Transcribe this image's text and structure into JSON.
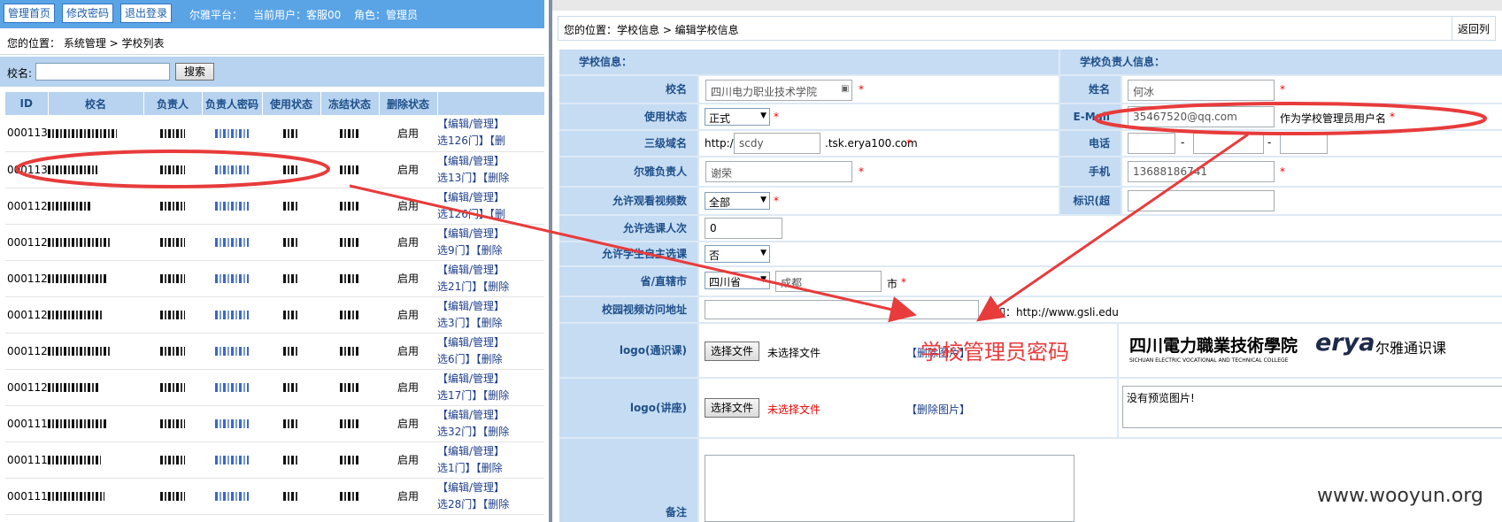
{
  "left": {
    "nav": {
      "home": "管理首页",
      "change_password": "修改密码",
      "logout": "退出登录",
      "platform": "尔雅平台：",
      "current_user": "当前用户：客服00",
      "role": "角色：管理员"
    },
    "breadcrumb": "您的位置： 系统管理 > 学校列表",
    "search": {
      "label": "校名:",
      "value": "",
      "button": "搜索"
    },
    "columns": [
      "ID",
      "校名",
      "负责人",
      "负责人密码",
      "使用状态",
      "冻结状态",
      "删除状态"
    ],
    "rows": [
      {
        "id": "000113",
        "state": "启用",
        "ops1": "【编辑/管理】",
        "ops2": "选126门】【删"
      },
      {
        "id": "000113",
        "state": "启用",
        "ops1": "【编辑/管理】",
        "ops2": "选13门】【删除"
      },
      {
        "id": "000112",
        "state": "启用",
        "ops1": "【编辑/管理】",
        "ops2": "选126门】【删"
      },
      {
        "id": "000112",
        "state": "启用",
        "ops1": "【编辑/管理】",
        "ops2": "选9门】【删除"
      },
      {
        "id": "000112",
        "state": "启用",
        "ops1": "【编辑/管理】",
        "ops2": "选21门】【删除"
      },
      {
        "id": "000112",
        "state": "启用",
        "ops1": "【编辑/管理】",
        "ops2": "选3门】【删除"
      },
      {
        "id": "000112",
        "state": "启用",
        "ops1": "【编辑/管理】",
        "ops2": "选6门】【删除"
      },
      {
        "id": "000112",
        "state": "启用",
        "ops1": "【编辑/管理】",
        "ops2": "选17门】【删除"
      },
      {
        "id": "000111",
        "state": "启用",
        "ops1": "【编辑/管理】",
        "ops2": "选32门】【删除"
      },
      {
        "id": "000111",
        "state": "启用",
        "ops1": "【编辑/管理】",
        "ops2": "选1门】【删除"
      },
      {
        "id": "000111",
        "state": "启用",
        "ops1": "【编辑/管理】",
        "ops2": "选28门】【删除"
      }
    ]
  },
  "right": {
    "breadcrumb": "您的位置：学校信息 > 编辑学校信息",
    "back": "返回列",
    "school_section": "学校信息：",
    "contact_section": "学校负责人信息：",
    "fields": {
      "school_name_label": "校名",
      "school_name_value": "四川电力职业技术学院",
      "status_label": "使用状态",
      "status_value": "正式",
      "subdomain_label": "三级域名",
      "subdomain_prefix": "http://",
      "subdomain_value": "scdy",
      "subdomain_suffix": ".tsk.erya100.com",
      "erya_owner_label": "尔雅负责人",
      "erya_owner_value": "谢荣",
      "video_label": "允许观看视频数",
      "video_value": "全部",
      "course_count_label": "允许选课人次",
      "course_count_value": "0",
      "self_select_label": "允许学生自主选课",
      "self_select_value": "否",
      "province_label": "省/直辖市",
      "province_value": "四川省",
      "city_value": "成都",
      "city_suffix": "市",
      "video_url_label": "校园视频访问地址",
      "video_url_value": "",
      "example_text": "例如：http://www.gsli.edu",
      "logo_course_label": "logo(通识课)",
      "choose_file": "选择文件",
      "no_file": "未选择文件",
      "delete_image": "【删除图片】",
      "logo_lecture_label": "logo(讲座)",
      "no_preview": "没有预览图片!",
      "remark_label": "备注",
      "name_label": "姓名",
      "name_value": "何冰",
      "email_label": "E-Mail",
      "email_value": "35467520@qq.com",
      "email_note": "作为学校管理员用户名",
      "phone_label": "电话",
      "phone_sep": "-",
      "mobile_label": "手机",
      "mobile_value": "13688186741",
      "flag_label": "标识(超星)",
      "required_mark": "*"
    },
    "logo_college_cn": "四川電力職業技術學院",
    "logo_college_en": "SICHUAN ELECTRIC VOCATIONAL AND TECHNICAL COLLEGE",
    "logo_erya": "erya",
    "logo_erya_cn": "尔雅通识课"
  },
  "annotation": "学校管理员密码",
  "watermark": "www.wooyun.org",
  "colors": {
    "annotation": "#e83b3b",
    "header_bg": "#5aa4e6",
    "label_bg": "#c5dcf3"
  }
}
